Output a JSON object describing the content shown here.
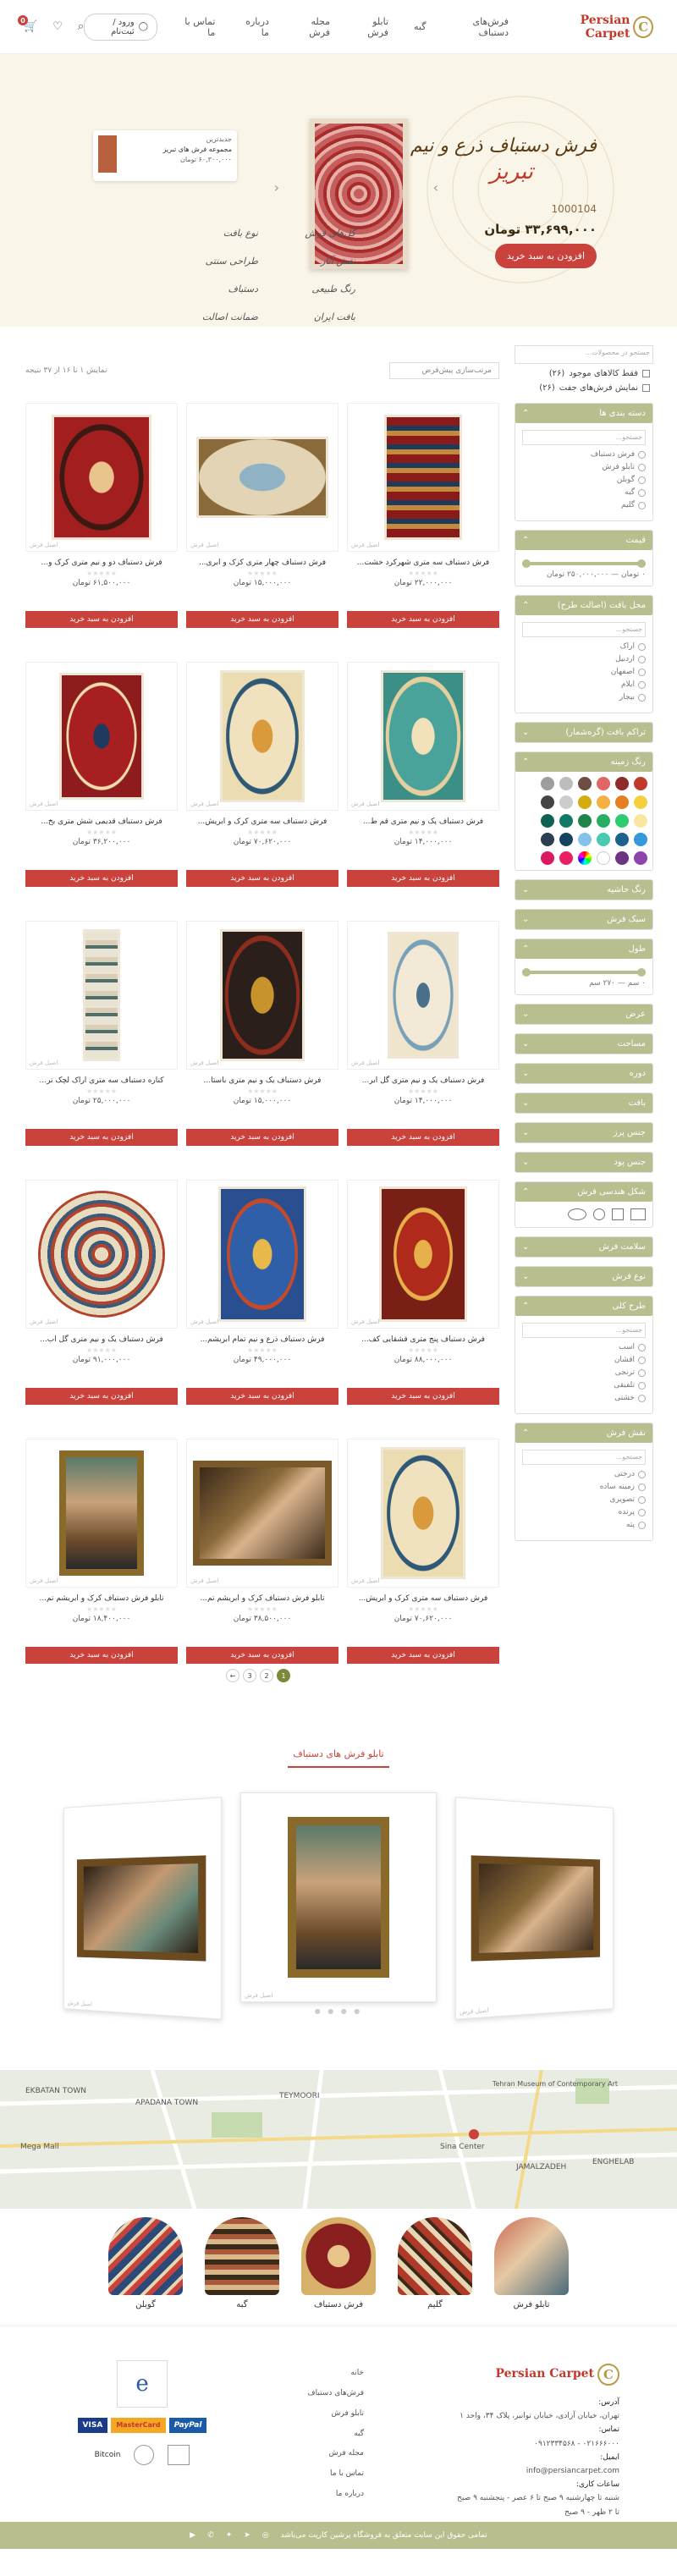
{
  "header": {
    "logo": "Persian Carpet",
    "logo_initial": "C",
    "nav": [
      {
        "label": "فرش‌های دستباف"
      },
      {
        "label": "گبه"
      },
      {
        "label": "تابلو فرش"
      },
      {
        "label": "مجله فرش"
      },
      {
        "label": "درباره ما"
      },
      {
        "label": "تماس با ما"
      }
    ],
    "login": "ورود / ثبت‌نام",
    "cart_count": "0"
  },
  "hero": {
    "title": "فرش دستباف ذرع و نیم",
    "city": "تبریز",
    "code": "1000104",
    "price": "۳۳,۶۹۹,۰۰۰ تومان",
    "button": "افزودن به سبد خرید",
    "mini_label": "جدیدترین",
    "mini_name": "مجموعه فرش های تبریز",
    "mini_price": "۶۰,۳۰۰,۰۰۰ تومان",
    "features": [
      "گل‌های فرش",
      "نوع بافت",
      "نقش آثار",
      "طراحی سنتی",
      "رنگ طبیعی",
      "دستباف",
      "بافت ایران",
      "ضمانت اصالت"
    ]
  },
  "toolbar": {
    "sort": "مرتب‌سازی پیش‌فرض",
    "count": "نمایش ۱ تا ۱۶ از ۳۷ نتیجه"
  },
  "sidebar": {
    "search": "جستجو در محصولات...",
    "in_stock": "فقط کالاهای موجود",
    "in_stock_count": "(۲۶)",
    "pair": "نمایش فرش‌های جفت",
    "pair_count": "(۲۶)",
    "category": {
      "title": "دسته بندی ها",
      "search": "جستجو...",
      "items": [
        "فرش دستباف",
        "تابلو فرش",
        "گوبلن",
        "گبه",
        "گلیم"
      ]
    },
    "price": {
      "title": "قیمت",
      "range": "۰ تومان — ۲۵۰,۰۰۰,۰۰۰ تومان"
    },
    "origin": {
      "title": "محل بافت (اصالت طرح)",
      "search": "جستجو...",
      "items": [
        "اراک",
        "اردبیل",
        "اصفهان",
        "ایلام",
        "بیجار"
      ]
    },
    "knots": {
      "title": "تراکم بافت (گره‌شمار)"
    },
    "color": {
      "title": "رنگ زمینه"
    },
    "border_color": {
      "title": "رنگ حاشیه"
    },
    "style": {
      "title": "سبک فرش"
    },
    "length": {
      "title": "طول",
      "range": "۰ سم — ۲۷۰ سم"
    },
    "width": {
      "title": "عرض"
    },
    "area": {
      "title": "مساحت"
    },
    "era": {
      "title": "دوره"
    },
    "weave": {
      "title": "بافت"
    },
    "material": {
      "title": "جنس پرز"
    },
    "warp": {
      "title": "جنس پود"
    },
    "shape": {
      "title": "شکل هندسی فرش"
    },
    "condition": {
      "title": "سلامت فرش"
    },
    "kind": {
      "title": "نوع فرش"
    },
    "design": {
      "title": "طرح کلی",
      "search": "جستجو...",
      "items": [
        "اسب",
        "افشان",
        "ترنجی",
        "تلفیقی",
        "خشتی"
      ]
    },
    "pattern": {
      "title": "نقش فرش",
      "search": "جستجو...",
      "items": [
        "درختی",
        "زمینه ساده",
        "تصویری",
        "پرنده",
        "پته"
      ]
    }
  },
  "products": [
    {
      "name": "فرش دستباف سه متری شهرکرد خشت...",
      "price": "۲۲,۰۰۰,۰۰۰ تومان"
    },
    {
      "name": "فرش دستباف چهار متری کرک و ابری...",
      "price": "۱۵,۰۰۰,۰۰۰ تومان"
    },
    {
      "name": "فرش دستباف دو و نیم متری کرک و...",
      "price": "۶۱,۵۰۰,۰۰۰ تومان"
    },
    {
      "name": "فرش دستباف یک و نیم متری قم ط...",
      "price": "۱۴,۰۰۰,۰۰۰ تومان"
    },
    {
      "name": "فرش دستباف سه متری کرک و ابریش...",
      "price": "۷۰,۶۲۰,۰۰۰ تومان"
    },
    {
      "name": "فرش دستباف قدیمی شش متری بخ...",
      "price": "۳۶,۲۰۰,۰۰۰ تومان"
    },
    {
      "name": "فرش دستباف یک و نیم متری گل ابر...",
      "price": "۱۴,۰۰۰,۰۰۰ تومان"
    },
    {
      "name": "فرش دستباف یک و نیم متری باستا...",
      "price": "۱۵,۰۰۰,۰۰۰ تومان"
    },
    {
      "name": "کناره دستباف سه متری اراک لچک تر...",
      "price": "۲۵,۰۰۰,۰۰۰ تومان"
    },
    {
      "name": "فرش دستباف پنج متری قشقایی کف...",
      "price": "۸۸,۰۰۰,۰۰۰ تومان"
    },
    {
      "name": "فرش دستباف ذرع و نیم تمام ابریشم...",
      "price": "۴۹,۰۰۰,۰۰۰ تومان"
    },
    {
      "name": "فرش دستباف یک و نیم متری گل اب...",
      "price": "۹۱,۰۰۰,۰۰۰ تومان"
    },
    {
      "name": "فرش دستباف سه متری کرک و ابریش...",
      "price": "۷۰,۶۲۰,۰۰۰ تومان"
    },
    {
      "name": "تابلو فرش دستباف کرک و ابریشم تم...",
      "price": "۳۸,۵۰۰,۰۰۰ تومان"
    },
    {
      "name": "تابلو فرش دستباف کرک و ابریشم تم...",
      "price": "۱۸,۴۰۰,۰۰۰ تومان"
    }
  ],
  "card_button": "افزودن به سبد خرید",
  "watermark": "اصیل فرش",
  "pager": [
    "1",
    "2",
    "3",
    "←"
  ],
  "section_tab": "تابلو فرش های دستباف",
  "map": {
    "labels": [
      "EKBATAN TOWN",
      "APADANA TOWN",
      "TEYMOORI",
      "Tehran Museum of Contemporary Art",
      "Mega Mall",
      "Sina Center",
      "JAMALZADEH",
      "ENGHELAB"
    ]
  },
  "categories": [
    "تابلو فرش",
    "گلیم",
    "فرش دستباف",
    "گبه",
    "گوبلن"
  ],
  "footer": {
    "address_label": "آدرس:",
    "address": "تهران، خیابان آزادی، خیابان توانیر، پلاک ۳۴، واحد ۱",
    "phone_label": "تماس:",
    "phone": "۰۲۱۶۶۶۰۰۰ - ۰۹۱۲۳۳۴۵۶۸",
    "email_label": "ایمیل:",
    "email": "info@persiancarpet.com",
    "hours_label": "ساعات کاری:",
    "hours": "شنبه تا چهارشنبه ۹ صبح تا ۶ عصر - پنجشنبه ۹ صبح تا ۲ ظهر - ۹ صبح",
    "links": [
      "خانه",
      "فرش‌های دستباف",
      "تابلو فرش",
      "گبه",
      "مجله فرش",
      "تماس با ما",
      "درباره ما"
    ],
    "payments": [
      "VISA",
      "MasterCard",
      "PayPal"
    ],
    "bitcoin": "Bitcoin",
    "copyright": "تمامی حقوق این سایت متعلق به فروشگاه پرشین کارپت می‌باشد"
  }
}
